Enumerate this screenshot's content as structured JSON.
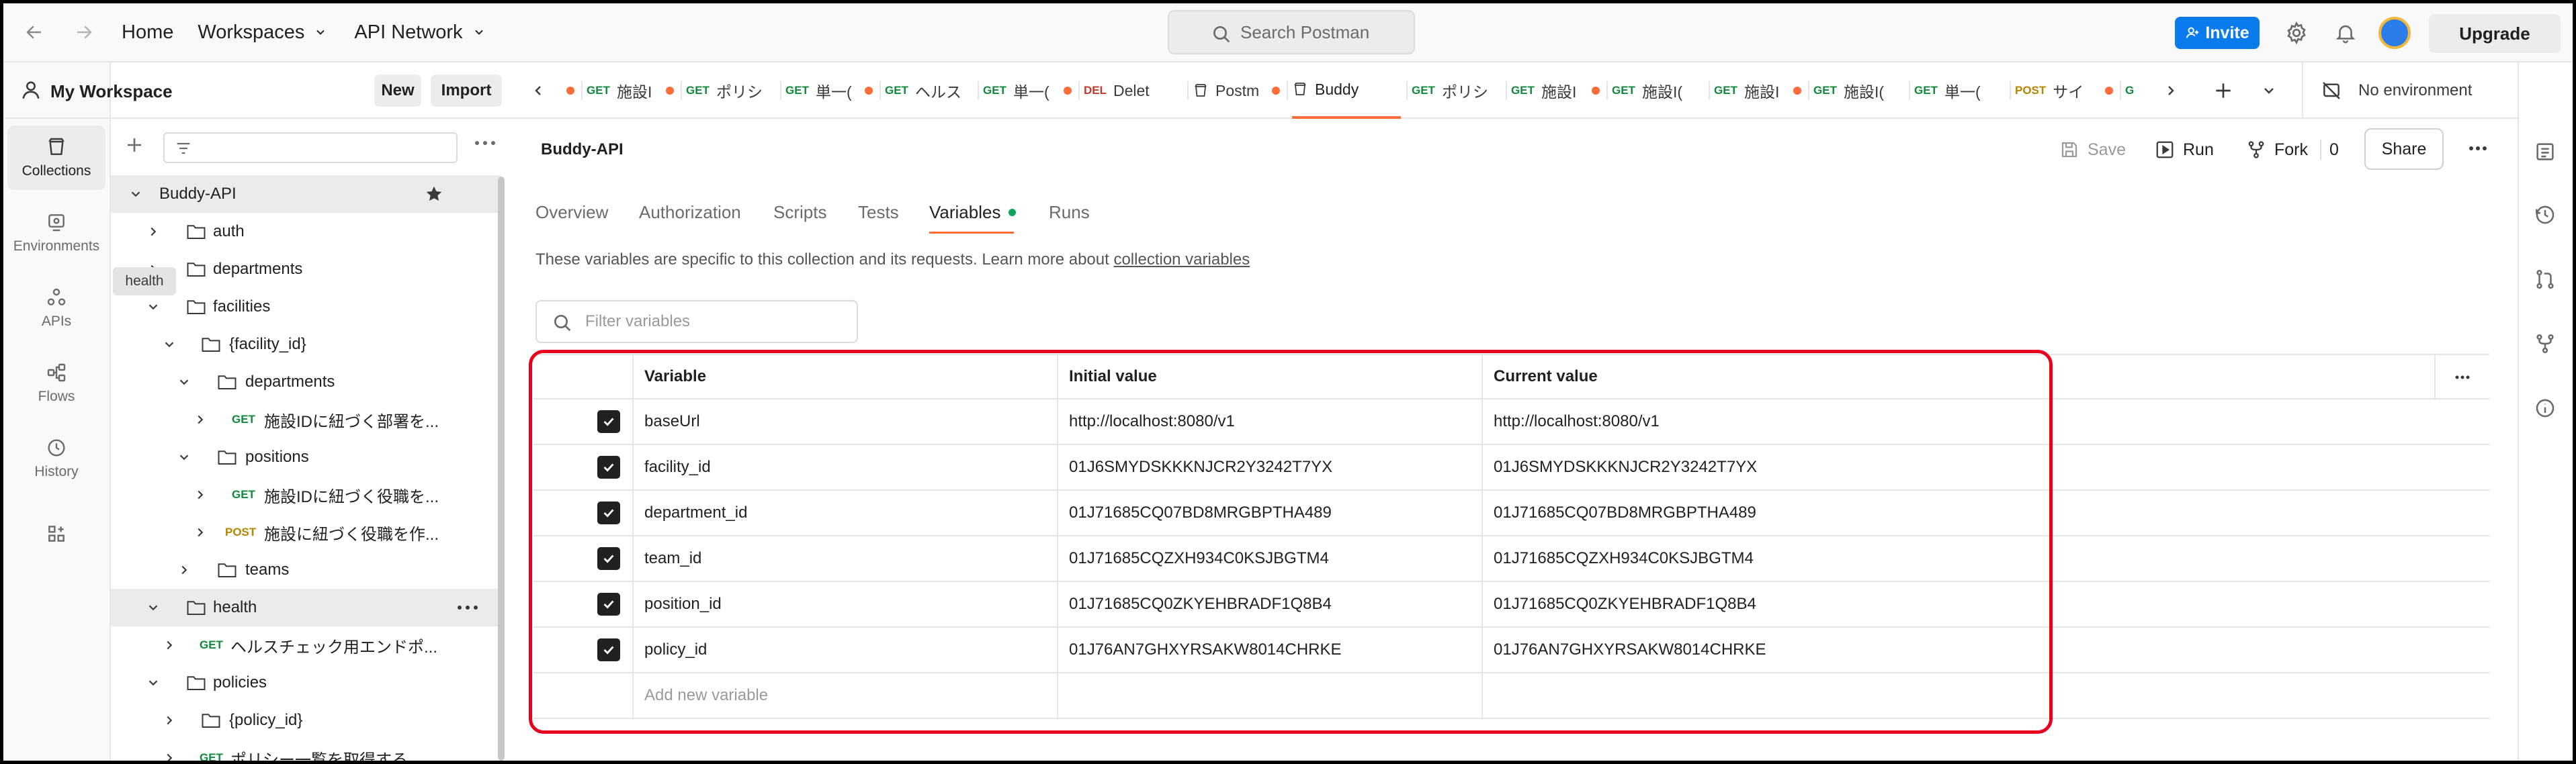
{
  "topbar": {
    "home": "Home",
    "workspaces": "Workspaces",
    "api_network": "API Network",
    "search_placeholder": "Search Postman",
    "invite": "Invite",
    "upgrade": "Upgrade"
  },
  "rail": [
    {
      "label": "Collections",
      "icon": "collections-icon",
      "active": true
    },
    {
      "label": "Environments",
      "icon": "environments-icon"
    },
    {
      "label": "APIs",
      "icon": "apis-icon"
    },
    {
      "label": "Flows",
      "icon": "flows-icon"
    },
    {
      "label": "History",
      "icon": "history-icon"
    }
  ],
  "sidebar": {
    "workspace_name": "My Workspace",
    "new_label": "New",
    "import_label": "Import",
    "tooltip": "health",
    "tree": [
      {
        "label": "Buddy-API",
        "kind": "collection"
      },
      {
        "label": "auth",
        "kind": "folder"
      },
      {
        "label": "departments",
        "kind": "folder"
      },
      {
        "label": "facilities",
        "kind": "folder"
      },
      {
        "label": "{facility_id}",
        "kind": "folder"
      },
      {
        "label": "departments",
        "kind": "folder"
      },
      {
        "method": "GET",
        "label": "施設IDに紐づく部署を...",
        "kind": "request"
      },
      {
        "label": "positions",
        "kind": "folder"
      },
      {
        "method": "GET",
        "label": "施設IDに紐づく役職を...",
        "kind": "request"
      },
      {
        "method": "POST",
        "label": "施設に紐づく役職を作...",
        "kind": "request"
      },
      {
        "label": "teams",
        "kind": "folder"
      },
      {
        "label": "health",
        "kind": "folder"
      },
      {
        "method": "GET",
        "label": "ヘルスチェック用エンドポ...",
        "kind": "request"
      },
      {
        "label": "policies",
        "kind": "folder"
      },
      {
        "label": "{policy_id}",
        "kind": "folder"
      },
      {
        "method": "GET",
        "label": "ポリシー一覧を取得する",
        "kind": "request"
      }
    ]
  },
  "tabs": [
    {
      "method": "GET",
      "label": "施設I"
    },
    {
      "method": "GET",
      "label": "ポリシ"
    },
    {
      "method": "GET",
      "label": "単一("
    },
    {
      "method": "GET",
      "label": "ヘルス"
    },
    {
      "method": "GET",
      "label": "単一("
    },
    {
      "method": "DEL",
      "label": "Delet"
    },
    {
      "method": "",
      "label": "Postm"
    },
    {
      "method": "",
      "label": "Buddy"
    },
    {
      "method": "GET",
      "label": "ポリシ"
    },
    {
      "method": "GET",
      "label": "施設I"
    },
    {
      "method": "GET",
      "label": "施設I("
    },
    {
      "method": "GET",
      "label": "施設I"
    },
    {
      "method": "GET",
      "label": "施設I("
    },
    {
      "method": "GET",
      "label": "単一("
    },
    {
      "method": "POST",
      "label": "サイ"
    },
    {
      "method": "G",
      "label": ""
    }
  ],
  "environment": "No environment",
  "collection": {
    "title": "Buddy-API",
    "save": "Save",
    "run": "Run",
    "fork": "Fork",
    "fork_count": "0",
    "share": "Share"
  },
  "subtabs": [
    "Overview",
    "Authorization",
    "Scripts",
    "Tests",
    "Variables",
    "Runs"
  ],
  "variables": {
    "description": "These variables are specific to this collection and its requests. Learn more about",
    "description_link": "collection variables",
    "filter_placeholder": "Filter variables",
    "headers": {
      "variable": "Variable",
      "initial": "Initial value",
      "current": "Current value"
    },
    "rows": [
      {
        "name": "baseUrl",
        "initial": "http://localhost:8080/v1",
        "current": "http://localhost:8080/v1"
      },
      {
        "name": "facility_id",
        "initial": "01J6SMYDSKKKNJCR2Y3242T7YX",
        "current": "01J6SMYDSKKKNJCR2Y3242T7YX"
      },
      {
        "name": "department_id",
        "initial": "01J71685CQ07BD8MRGBPTHA489",
        "current": "01J71685CQ07BD8MRGBPTHA489"
      },
      {
        "name": "team_id",
        "initial": "01J71685CQZXH934C0KSJBGTM4",
        "current": "01J71685CQZXH934C0KSJBGTM4"
      },
      {
        "name": "position_id",
        "initial": "01J71685CQ0ZKYEHBRADF1Q8B4",
        "current": "01J71685CQ0ZKYEHBRADF1Q8B4"
      },
      {
        "name": "policy_id",
        "initial": "01J76AN7GHXYRSAKW8014CHRKE",
        "current": "01J76AN7GHXYRSAKW8014CHRKE"
      }
    ],
    "add_placeholder": "Add new variable"
  },
  "colors": {
    "accent": "#ff6c37",
    "invite": "#097bed",
    "get": "#0f8a3a",
    "post": "#b88400",
    "delete": "#c0392b",
    "highlight": "#e8001d"
  }
}
